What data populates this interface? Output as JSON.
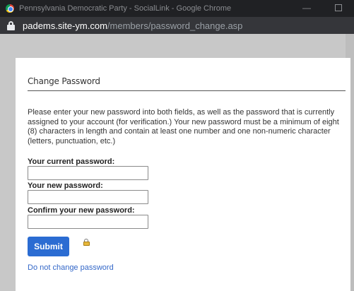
{
  "browser": {
    "window_title": "Pennsylvania Democratic Party - SocialLink - Google Chrome",
    "minimize_glyph": "—",
    "url_host": "padems.site-ym.com",
    "url_path": "/members/password_change.asp"
  },
  "page": {
    "title": "Change Password",
    "instructions": "Please enter your new password into both fields, as well as the password that is currently assigned to your account (for verification.) Your new password must be a minimum of eight (8) characters in length and contain at least one number and one non-numeric character (letters, punctuation, etc.)",
    "fields": {
      "current_label": "Your current password:",
      "current_value": "",
      "new_label": "Your new password:",
      "new_value": "",
      "confirm_label": "Confirm your new password:",
      "confirm_value": ""
    },
    "submit_label": "Submit",
    "cancel_link": "Do not change password"
  },
  "colors": {
    "accent": "#2b6cd2",
    "link": "#3367c8",
    "titlebar": "#202124",
    "addressbar": "#35363a"
  },
  "icons": [
    "chrome-icon",
    "lock-icon",
    "padlock-icon"
  ]
}
